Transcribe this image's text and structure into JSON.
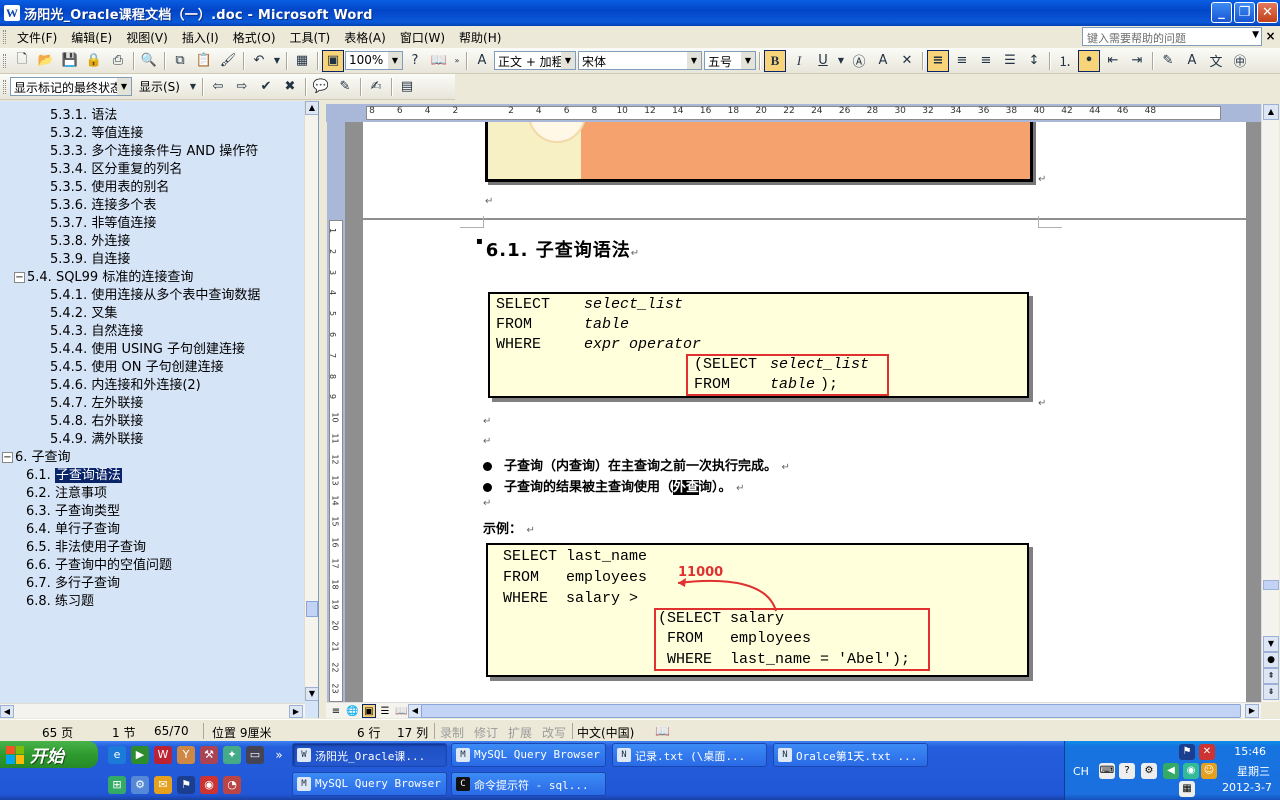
{
  "window": {
    "title": "汤阳光_Oracle课程文档（一）.doc - Microsoft Word",
    "app_icon": "W"
  },
  "menu": {
    "items": [
      "文件(F)",
      "编辑(E)",
      "视图(V)",
      "插入(I)",
      "格式(O)",
      "工具(T)",
      "表格(A)",
      "窗口(W)",
      "帮助(H)"
    ],
    "help_placeholder": "键入需要帮助的问题"
  },
  "toolbar": {
    "zoom": "100%",
    "style": "正文 + 加粗",
    "font": "宋体",
    "size": "五号",
    "markup_view": "显示标记的最终状态",
    "show_label": "显示(S)"
  },
  "docmap": {
    "items": [
      {
        "label": "5.3.1. 语法",
        "level": 3
      },
      {
        "label": "5.3.2. 等值连接",
        "level": 3
      },
      {
        "label": "5.3.3. 多个连接条件与 AND 操作符",
        "level": 3
      },
      {
        "label": "5.3.4. 区分重复的列名",
        "level": 3
      },
      {
        "label": "5.3.5. 使用表的别名",
        "level": 3
      },
      {
        "label": "5.3.6. 连接多个表",
        "level": 3
      },
      {
        "label": "5.3.7. 非等值连接",
        "level": 3
      },
      {
        "label": "5.3.8. 外连接",
        "level": 3
      },
      {
        "label": "5.3.9. 自连接",
        "level": 3
      },
      {
        "label": "5.4. SQL99 标准的连接查询",
        "level": 2,
        "expander": "−"
      },
      {
        "label": "5.4.1. 使用连接从多个表中查询数据",
        "level": 3
      },
      {
        "label": "5.4.2. 叉集",
        "level": 3
      },
      {
        "label": "5.4.3. 自然连接",
        "level": 3
      },
      {
        "label": "5.4.4. 使用 USING 子句创建连接",
        "level": 3
      },
      {
        "label": "5.4.5. 使用 ON 子句创建连接",
        "level": 3
      },
      {
        "label": "5.4.6. 内连接和外连接(2)",
        "level": 3
      },
      {
        "label": "5.4.7. 左外联接",
        "level": 3
      },
      {
        "label": "5.4.8. 右外联接",
        "level": 3
      },
      {
        "label": "5.4.9. 满外联接",
        "level": 3
      },
      {
        "label": "6. 子查询",
        "level": 1,
        "expander": "−"
      },
      {
        "label": "6.1. 子查询语法",
        "level": 2,
        "selected": true,
        "num": "6.1.",
        "text": "子查询语法"
      },
      {
        "label": "6.2. 注意事项",
        "level": 2
      },
      {
        "label": "6.3. 子查询类型",
        "level": 2
      },
      {
        "label": "6.4. 单行子查询",
        "level": 2
      },
      {
        "label": "6.5. 非法使用子查询",
        "level": 2
      },
      {
        "label": "6.6. 子查询中的空值问题",
        "level": 2
      },
      {
        "label": "6.7. 多行子查询",
        "level": 2
      },
      {
        "label": "6.8. 练习题",
        "level": 2
      }
    ]
  },
  "ruler": {
    "numbers": [
      "8",
      "6",
      "4",
      "2",
      "",
      "2",
      "4",
      "6",
      "8",
      "10",
      "12",
      "14",
      "16",
      "18",
      "20",
      "22",
      "24",
      "26",
      "28",
      "30",
      "32",
      "34",
      "36",
      "38",
      "40",
      "42",
      "44",
      "46",
      "48"
    ],
    "vnumbers": [
      "1",
      "2",
      "3",
      "4",
      "5",
      "6",
      "7",
      "8",
      "9",
      "10",
      "11",
      "12",
      "13",
      "14",
      "15",
      "16",
      "17",
      "18",
      "19",
      "20",
      "21",
      "22",
      "23"
    ]
  },
  "document": {
    "heading_num": "6.1.",
    "heading_text": "子查询语法",
    "syntax": {
      "l1_kw": "SELECT",
      "l1_val": "select_list",
      "l2_kw": "FROM",
      "l2_val": "table",
      "l3_kw": "WHERE",
      "l3_val": "expr operator",
      "l4_kw": "(SELECT",
      "l4_val": "select_list",
      "l5_kw": "FROM",
      "l5_val": "table",
      "l5_end": ");"
    },
    "bullet1": "子查询（内查询）在主查询之前一次执行完成。",
    "bullet2_pre": "子查询的结果被主查询使用（",
    "bullet2_hl": "外查",
    "bullet2_post": "询）。",
    "example_label": "示例：",
    "example": {
      "l1": "SELECT last_name",
      "l2": "FROM   employees",
      "l3": "WHERE  salary >",
      "l4": "(SELECT salary",
      "l5": " FROM   employees",
      "l6": " WHERE  last_name = 'Abel');",
      "annotation": "11000"
    },
    "paragraph_mark": "↵"
  },
  "status": {
    "page": "65 页",
    "section": "1 节",
    "pages": "65/70",
    "position": "位置 9厘米",
    "line": "6 行",
    "col": "17 列",
    "rec": "录制",
    "trk": "修订",
    "ext": "扩展",
    "ovr": "改写",
    "lang": "中文(中国)"
  },
  "taskbar": {
    "start": "开始",
    "tasks": [
      {
        "label": "汤阳光_Oracle课...",
        "icon": "W",
        "active": true
      },
      {
        "label": "MySQL Query Browser",
        "icon": "M"
      },
      {
        "label": "记录.txt (\\桌面...",
        "icon": "N"
      },
      {
        "label": "Oralce第1天.txt ...",
        "icon": "N"
      },
      {
        "label": "MySQL Query Browser",
        "icon": "M"
      },
      {
        "label": "命令提示符 - sql...",
        "icon": "C"
      }
    ],
    "clock_time": "15:46",
    "clock_day": "星期三",
    "clock_date": "2012-3-7",
    "ime": "CH"
  },
  "colors": {
    "accent": "#0a246a",
    "code_bg": "#ffffdc",
    "red": "#e03030",
    "docmap_bg": "#d6e4f7"
  }
}
